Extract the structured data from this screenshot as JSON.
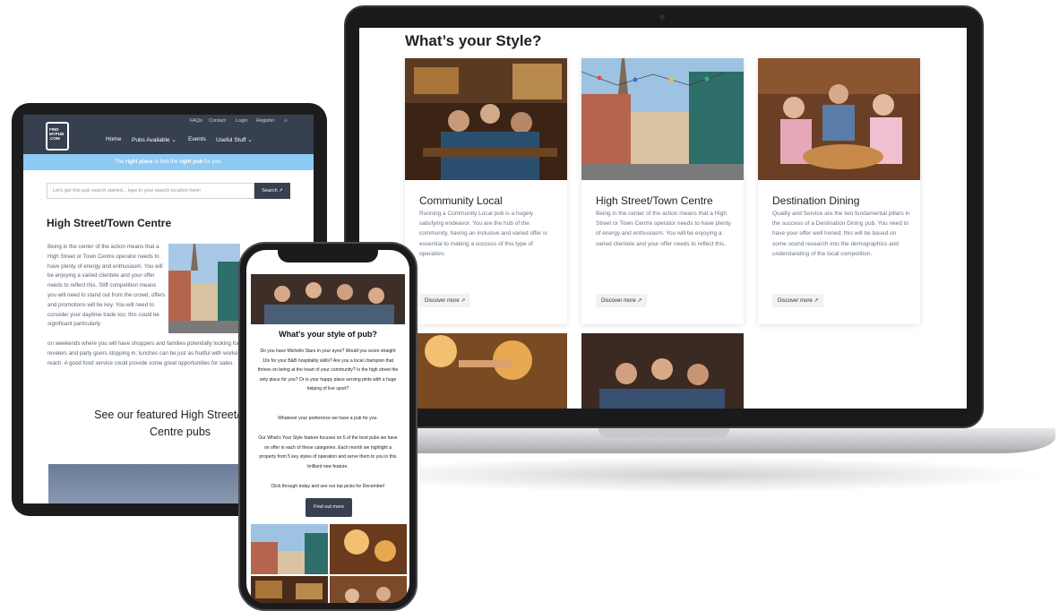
{
  "laptop": {
    "heading": "What’s your Style?",
    "cards": [
      {
        "title": "Community Local",
        "body": "Running a Community Local pub is a hugely satisfying endeavor. You are the hub of the community, having an inclusive and varied offer is essential to making a success of this type of operation.",
        "button": "Discover more ↗"
      },
      {
        "title": "High Street/Town Centre",
        "body": "Being in the center of the action means that a High Street or Town Centre operator needs to have plenty of energy and enthusiasm. You will be enjoying a varied clientele and your offer needs to reflect this.",
        "button": "Discover more ↗"
      },
      {
        "title": "Destination Dining",
        "body": "Quality and Service are the two fundamental pillars in the success of a Destination Dining pub. You need to have your offer well honed; this will be based on some sound research into the demographics and understanding of the local competition.",
        "button": "Discover more ↗"
      }
    ]
  },
  "tablet": {
    "logo": [
      "FIND",
      "MYPUB",
      ".COM"
    ],
    "top_links": [
      "FAQs",
      "Contact",
      "Login",
      "Register"
    ],
    "main_links": [
      "Home",
      "Pubs Available ⌄",
      "Events",
      "Useful Stuff ⌄"
    ],
    "band": {
      "pre": "The ",
      "b1": "right place",
      "mid": " to find the ",
      "b2": "right pub",
      "post": " for you."
    },
    "search": {
      "placeholder": "Let's get this pub search started... type in your search location here!",
      "button": "Search ↗"
    },
    "heading": "High Street/Town Centre",
    "para": "Being in the center of the action means that a High Street or Town Centre operator needs to have plenty of energy and enthusiasm. You will be enjoying a varied clientele and your offer needs to reflect this. Stiff competition means you will need to stand out from the crowd, offers and promotions will be key. You will need to consider your daytime trade too; this could be significant particularly",
    "para2": "on weekends where you will have shoppers and families potentially looking for respite by day and by night the revelers and party goers stopping in; lunches can be just as fruitful with workers and local businesses within reach. A good food service could provide some great opportunities for sales.",
    "featured": "See our featured High Street/Town Centre pubs"
  },
  "phone": {
    "heading": "What's your style of pub?",
    "p1": "Do you have Michelin Stars in your eyes? Would you score straight 10s for your B&B hospitality skills? Are you a local champion that thrives on being at the heart of your community? Is the high street the only place for you? Or is your happy place serving pints with a huge helping of live sport?",
    "p2": "Whatever your preference we have a pub for you.",
    "p3": "Our What's Your Style feature focuses on 5 of the best pubs we have on offer in each of these categories. Each month we highlight a property from 5 key styles of operation and serve them to you in this brilliant new feature.",
    "p4": "Click through today and see our top picks for December!",
    "button": "Find out more"
  }
}
